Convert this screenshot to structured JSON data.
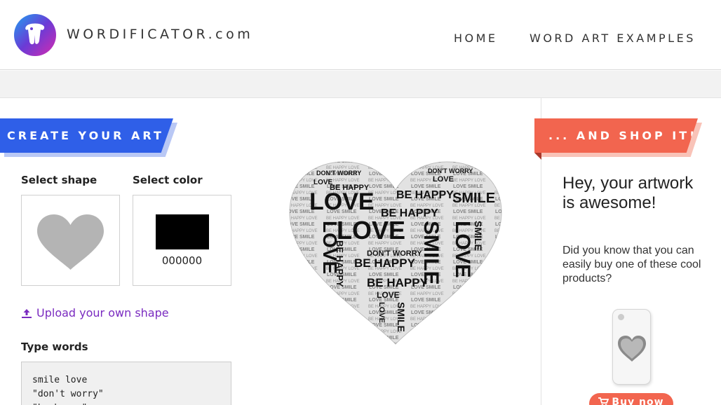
{
  "header": {
    "brand": "WORDIFICATOR.com",
    "nav": [
      {
        "label": "HOME"
      },
      {
        "label": "WORD ART EXAMPLES"
      }
    ]
  },
  "create": {
    "ribbon": "CREATE YOUR ART",
    "select_shape_label": "Select shape",
    "select_color_label": "Select color",
    "selected_shape_icon": "heart-icon",
    "selected_color_value": "000000",
    "selected_color_hex": "#000000",
    "upload_label": "Upload your own shape",
    "type_words_label": "Type words",
    "words_text": "smile love\n\"don't worry\"\n\"be happy\""
  },
  "preview": {
    "words": [
      "LOVE",
      "SMILE",
      "BE HAPPY",
      "DON'T WORRY"
    ]
  },
  "shop": {
    "ribbon": "... AND SHOP IT!",
    "title": "Hey, your artwork is awesome!",
    "text": "Did you know that you can easily buy one of these cool products?",
    "buy_label": "Buy now",
    "cart_icon": "cart-icon"
  },
  "colors": {
    "accent_blue": "#2f5fe8",
    "accent_coral": "#f2654f",
    "link_purple": "#7a2bc0"
  }
}
